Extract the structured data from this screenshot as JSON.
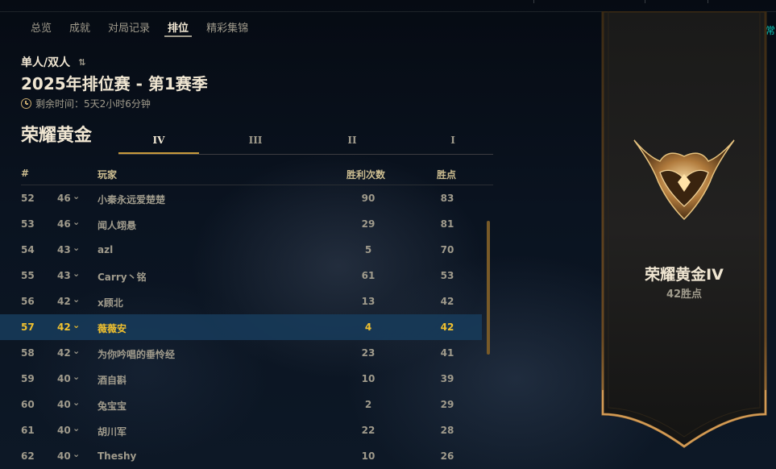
{
  "nav": {
    "items": [
      {
        "label": "总览",
        "active": false
      },
      {
        "label": "成就",
        "active": false
      },
      {
        "label": "对局记录",
        "active": false
      },
      {
        "label": "排位",
        "active": true
      },
      {
        "label": "精彩集锦",
        "active": false
      }
    ]
  },
  "queue": {
    "label": "单人/双人",
    "icon": "sort-icon"
  },
  "season": {
    "title": "2025年排位赛 - 第1赛季",
    "remaining": "剩余时间：5天2小时6分钟"
  },
  "tier": {
    "name": "荣耀黄金",
    "divisions": [
      "IV",
      "III",
      "II",
      "I"
    ],
    "active_division": "IV"
  },
  "table": {
    "headers": {
      "rank": "#",
      "player": "玩家",
      "wins": "胜利次数",
      "points": "胜点"
    },
    "rows": [
      {
        "rank": "52",
        "lp": "46",
        "player": "小秦永远爱楚楚",
        "wins": "90",
        "points": "83"
      },
      {
        "rank": "53",
        "lp": "46",
        "player": "闻人翊悬",
        "wins": "29",
        "points": "81"
      },
      {
        "rank": "54",
        "lp": "43",
        "player": "azl",
        "wins": "5",
        "points": "70"
      },
      {
        "rank": "55",
        "lp": "43",
        "player": "Carry丶铭",
        "wins": "61",
        "points": "53"
      },
      {
        "rank": "56",
        "lp": "42",
        "player": "x顾北",
        "wins": "13",
        "points": "42"
      },
      {
        "rank": "57",
        "lp": "42",
        "player": "薇薇安",
        "wins": "4",
        "points": "42",
        "selected": true
      },
      {
        "rank": "58",
        "lp": "42",
        "player": "为你吟唱的垂怜经",
        "wins": "23",
        "points": "41"
      },
      {
        "rank": "59",
        "lp": "40",
        "player": "酒自斟",
        "wins": "10",
        "points": "39"
      },
      {
        "rank": "60",
        "lp": "40",
        "player": "兔宝宝",
        "wins": "2",
        "points": "29"
      },
      {
        "rank": "61",
        "lp": "40",
        "player": "胡川军",
        "wins": "22",
        "points": "28"
      },
      {
        "rank": "62",
        "lp": "40",
        "player": "Theshy",
        "wins": "10",
        "points": "26"
      }
    ]
  },
  "side": {
    "war_link": "战区系统常",
    "banner_tier": "荣耀黄金IV",
    "banner_lp": "42胜点",
    "emblem_icon": "gold-rank-emblem-icon"
  },
  "colors": {
    "gold": "#c89b3c",
    "text_light": "#f0e6d2",
    "text_muted": "#a09b8c",
    "selected_text": "#f0c12f",
    "selected_bg": "#173c5c",
    "link": "#0ac8b9"
  }
}
